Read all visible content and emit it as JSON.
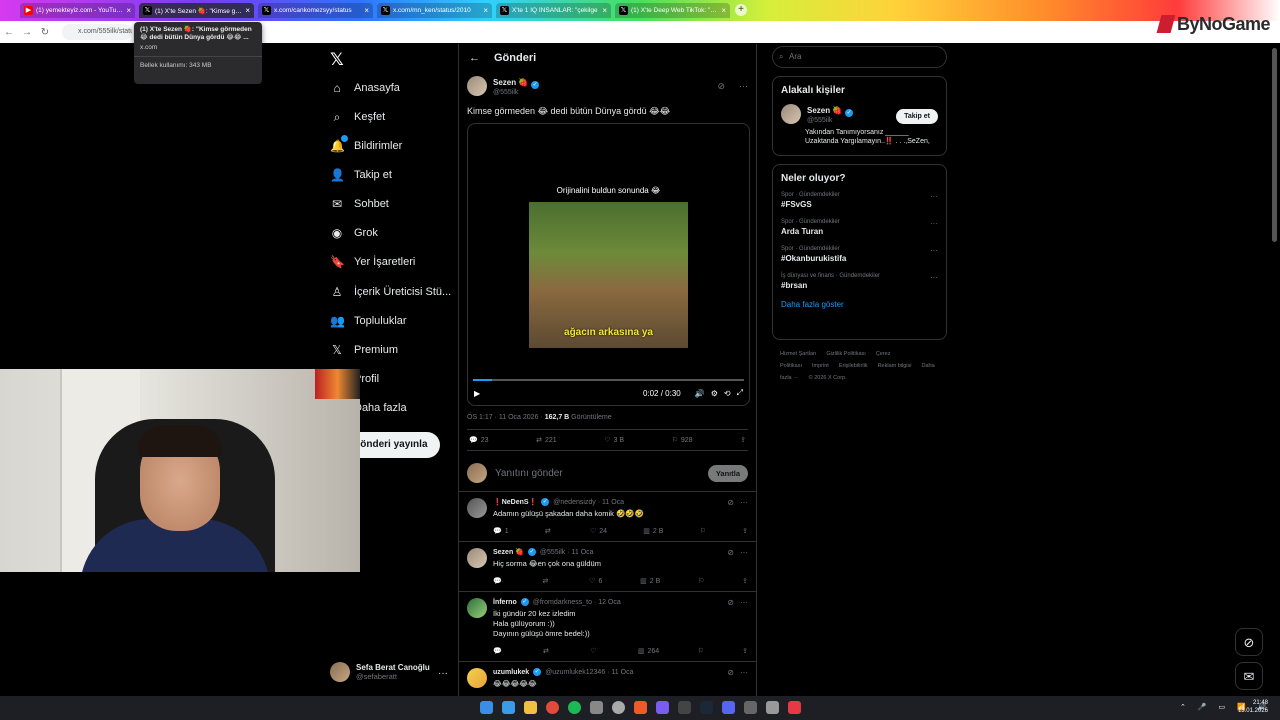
{
  "browser": {
    "tabs": [
      {
        "title": "(1) yemekteyiz.com - YouTube",
        "color": "#ff0000"
      },
      {
        "title": "(1) X'te Sezen 🍓: \"Kimse görm",
        "color": "#000000"
      },
      {
        "title": "x.com/cankomezsyy/status",
        "color": "#000000"
      },
      {
        "title": "x.com/mn_ken/status/2010",
        "color": "#000000"
      },
      {
        "title": "X'te 1 IQ İNSANLAR: \"çekilge",
        "color": "#000000"
      },
      {
        "title": "(1) X'te Deep Web TikTok: \"sır\"",
        "color": "#000000"
      }
    ],
    "url": "x.com/555ilk/status",
    "brand": "ByNoGame",
    "tooltip": {
      "title": "(1) X'te Sezen 🍓: \"Kimse görmeden 😂 dedi bütün Dünya gördü 😂😂 ...",
      "host": "x.com",
      "memory": "Bellek kullanımı: 343 MB"
    }
  },
  "nav": {
    "items": [
      {
        "label": "Anasayfa",
        "icon": "⌂"
      },
      {
        "label": "Keşfet",
        "icon": "⌕"
      },
      {
        "label": "Bildirimler",
        "icon": "🔔"
      },
      {
        "label": "Takip et",
        "icon": "👤"
      },
      {
        "label": "Sohbet",
        "icon": "✉"
      },
      {
        "label": "Grok",
        "icon": "◉"
      },
      {
        "label": "Yer İşaretleri",
        "icon": "🔖"
      },
      {
        "label": "İçerik Üreticisi Stü...",
        "icon": "♙"
      },
      {
        "label": "Topluluklar",
        "icon": "👥"
      },
      {
        "label": "Premium",
        "icon": "𝕏"
      },
      {
        "label": "Profil",
        "icon": "●"
      },
      {
        "label": "Daha fazla",
        "icon": "⋯"
      }
    ],
    "post_button": "Gönderi yayınla",
    "account": {
      "name": "Sefa Berat Canoğlu",
      "handle": "@sefaberatt"
    }
  },
  "main": {
    "header": "Gönderi",
    "post": {
      "name": "Sezen 🍓",
      "handle": "@555ilk",
      "text": "Kimse görmeden 😂 dedi bütün Dünya gördü 😂😂",
      "video_caption_top": "Orijinalini buldun sonunda 😂",
      "video_subtitle": "ağacın arkasına ya",
      "video_time": "0:02 / 0:30",
      "video_progress": 0.07,
      "meta_time": "ÖS 1:17 · 11 Oca 2026 · ",
      "meta_views": "162,7 B",
      "meta_views_label": " Görüntüleme",
      "replies": "23",
      "reposts": "221",
      "likes": "3 B",
      "bookmarks": "928"
    },
    "reply_placeholder": "Yanıtını gönder",
    "reply_button": "Yanıtla",
    "replies": [
      {
        "name": "❗NeDenS❗",
        "handle": "@nedensizdy · 11 Oca",
        "text": "Adamın gülüşü şakadan daha komik 🤣🤣🤣",
        "r": "1",
        "rt": "",
        "l": "24",
        "v": "2 B"
      },
      {
        "name": "Sezen 🍓",
        "handle": "@555ilk · 11 Oca",
        "text": "Hiç sorma 😂en çok ona güldüm",
        "r": "",
        "rt": "",
        "l": "6",
        "v": "2 B"
      },
      {
        "name": "İnferno",
        "handle": "@fromdarkness_to · 12 Oca",
        "text": "İki gündür 20 kez izledim\nHala gülüyorum :))\nDayının gülüşü ömre bedel:))",
        "r": "",
        "rt": "",
        "l": "",
        "v": "264"
      },
      {
        "name": "uzumlukek",
        "handle": "@uzumlukek12346 · 11 Oca",
        "text": "😂😂😂😂😂",
        "r": "",
        "rt": "",
        "l": "",
        "v": ""
      }
    ]
  },
  "right": {
    "search_placeholder": "Ara",
    "related_title": "Alakalı kişiler",
    "related": {
      "name": "Sezen 🍓",
      "handle": "@555ilk",
      "bio": "Yakından Tanımıyorsanız ______ Uzaktanda Yargılamayın..‼️ . . .,SeZen,",
      "follow": "Takip et"
    },
    "trends_title": "Neler oluyor?",
    "trends": [
      {
        "cat": "Spor · Gündemdekiler",
        "title": "#FSvGS"
      },
      {
        "cat": "Spor · Gündemdekiler",
        "title": "Arda Turan"
      },
      {
        "cat": "Spor · Gündemdekiler",
        "title": "#Okanburukistifa"
      },
      {
        "cat": "İş dünyası ve finans · Gündemdekiler",
        "title": "#brsan"
      }
    ],
    "show_more": "Daha fazla göster",
    "footer": [
      "Hizmet Şartları",
      "Gizlilik Politikası",
      "Çerez Politikası",
      "Imprint",
      "Erişilebilirlik",
      "Reklam bilgisi",
      "Daha fazla ···",
      "© 2026 X Corp."
    ]
  },
  "taskbar": {
    "time": "21:48",
    "date": "13.01.2026"
  }
}
